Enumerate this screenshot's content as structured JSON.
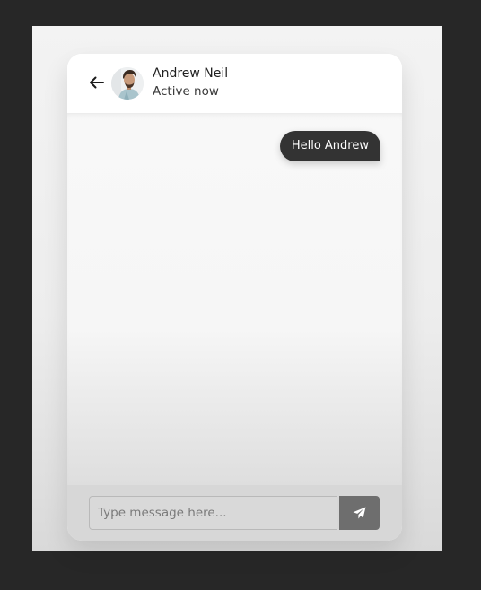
{
  "header": {
    "back_icon": "arrow-left-icon",
    "user_name": "Andrew Neil",
    "status": "Active now"
  },
  "messages": [
    {
      "direction": "outgoing",
      "text": "Hello Andrew"
    }
  ],
  "composer": {
    "placeholder": "Type message here...",
    "send_icon": "paper-plane-icon"
  },
  "colors": {
    "page_background": "#272727",
    "bubble_outgoing": "#333333",
    "send_button": "#6e6e6e",
    "input_area": "#d7d7d7"
  }
}
